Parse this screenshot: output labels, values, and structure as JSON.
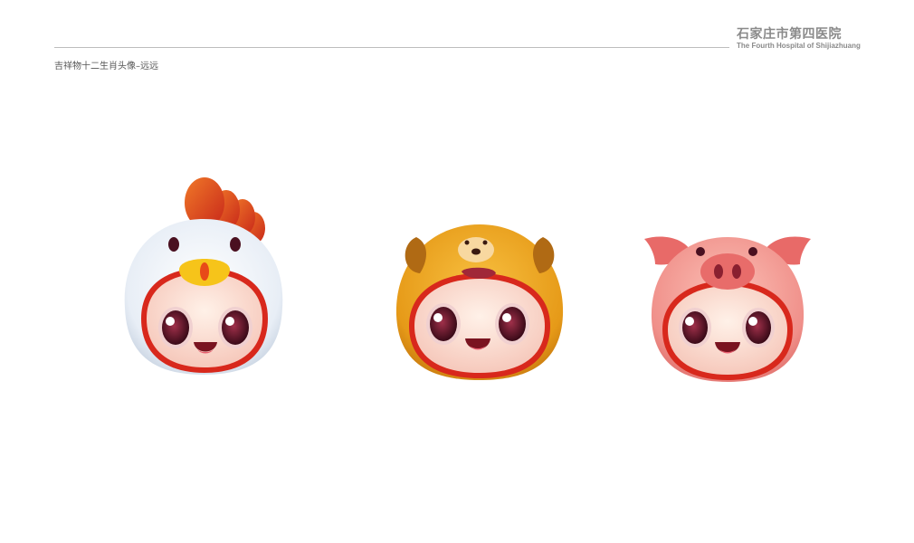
{
  "header": {
    "hospital_name_cn": "石家庄市第四医院",
    "hospital_name_en": "The Fourth Hospital of Shijiazhuang"
  },
  "page": {
    "title": "吉祥物十二生肖头像–远远"
  },
  "mascots": [
    {
      "name": "rooster-mascot",
      "hood_color": "#eef3f8",
      "accent_color": "#e84a18"
    },
    {
      "name": "dog-mascot",
      "hood_color": "#e8a020",
      "accent_color": "#b86a10"
    },
    {
      "name": "pig-mascot",
      "hood_color": "#f4a09a",
      "accent_color": "#e06a66"
    }
  ]
}
